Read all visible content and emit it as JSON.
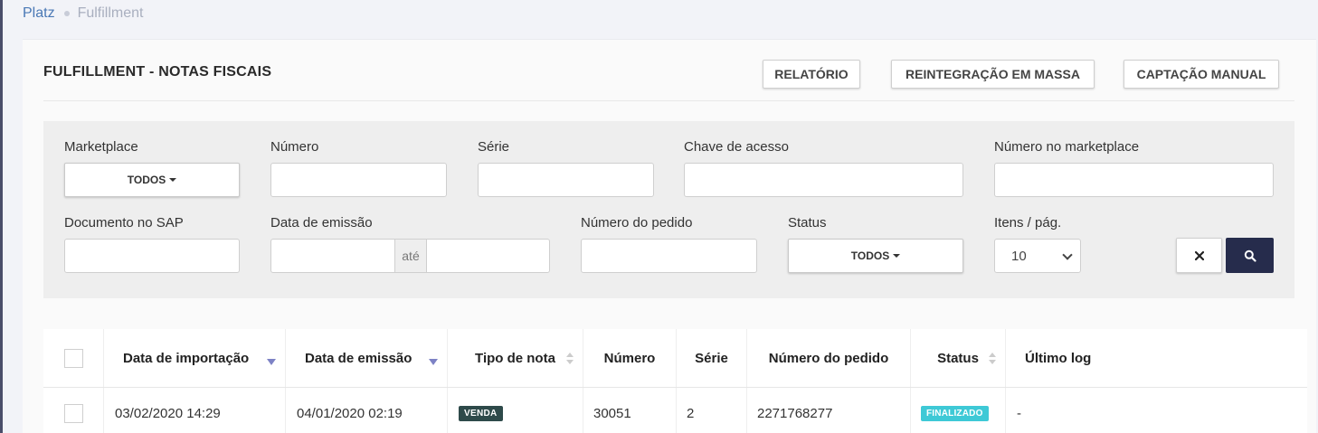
{
  "breadcrumb": {
    "home": "Platz",
    "current": "Fulfillment"
  },
  "page": {
    "title": "FULFILLMENT - NOTAS FISCAIS",
    "buttons": {
      "report": "RELATÓRIO",
      "reintegration": "REINTEGRAÇÃO EM MASSA",
      "manual_capture": "CAPTAÇÃO MANUAL"
    }
  },
  "filters": {
    "marketplace": {
      "label": "Marketplace",
      "value": "TODOS"
    },
    "numero": {
      "label": "Número",
      "value": ""
    },
    "serie": {
      "label": "Série",
      "value": ""
    },
    "chave": {
      "label": "Chave de acesso",
      "value": ""
    },
    "numero_marketplace": {
      "label": "Número no marketplace",
      "value": ""
    },
    "documento_sap": {
      "label": "Documento no SAP",
      "value": ""
    },
    "data_emissao": {
      "label": "Data de emissão",
      "separator": "até",
      "from": "",
      "to": ""
    },
    "numero_pedido": {
      "label": "Número do pedido",
      "value": ""
    },
    "status": {
      "label": "Status",
      "value": "TODOS"
    },
    "itens_pag": {
      "label": "Itens / pág.",
      "value": "10"
    }
  },
  "table": {
    "headers": [
      "Data de importação",
      "Data de emissão",
      "Tipo de nota",
      "Número",
      "Série",
      "Número do pedido",
      "Status",
      "Último log"
    ],
    "rows": [
      {
        "data_importacao": "03/02/2020 14:29",
        "data_emissao": "04/01/2020 02:19",
        "tipo": "VENDA",
        "numero": "30051",
        "serie": "2",
        "pedido": "2271768277",
        "status": "FINALIZADO",
        "ultimo_log": "-"
      }
    ]
  },
  "colors": {
    "primary_dark": "#262c4c",
    "badge_venda": "#2e4a4a",
    "badge_finalizado": "#3ec9d6",
    "sort_active": "#7d82c5",
    "link": "#4a78b5"
  }
}
